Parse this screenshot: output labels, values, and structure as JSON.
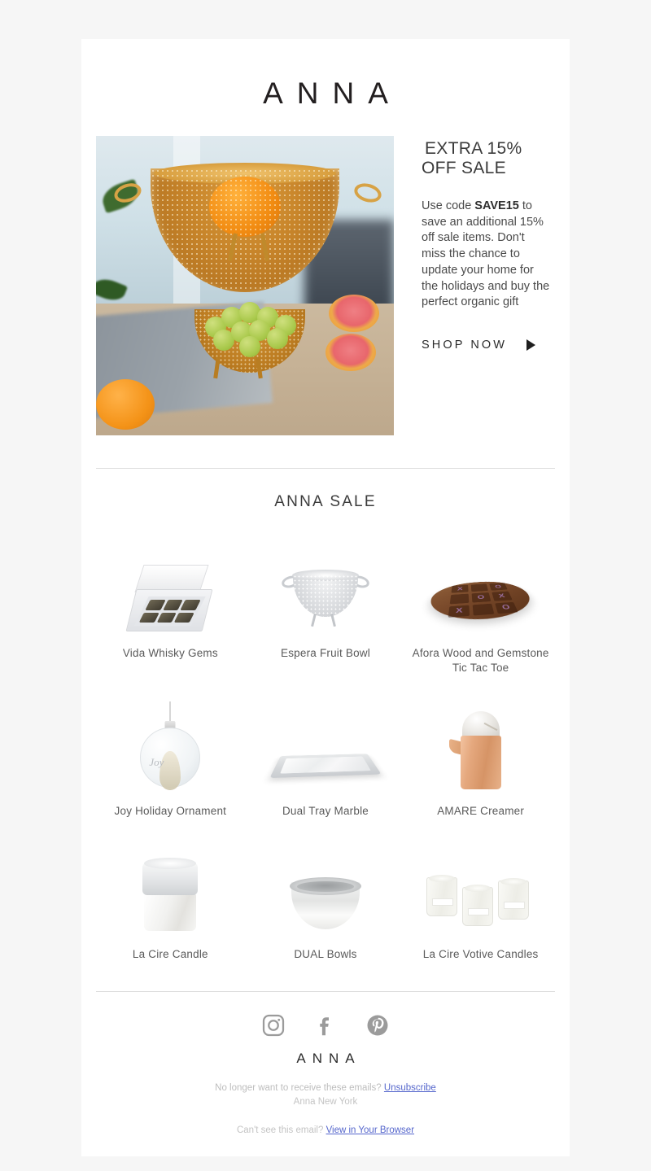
{
  "brand": {
    "logo": "ANNA",
    "footer_logo": "ANNA"
  },
  "hero": {
    "heading_line1": "EXTRA 15%",
    "heading_line2": "OFF SALE",
    "body_pre": "Use code ",
    "body_code": "SAVE15",
    "body_post": " to save an additional 15% off sale items.  Don't miss the chance to update your home for the holidays and buy the perfect organic gift",
    "cta_label": "SHOP NOW",
    "image_alt": "gold perforated fruit bowl with orange, grapes and grapefruit"
  },
  "sale": {
    "title": "ANNA SALE",
    "products": [
      {
        "name": "Vida Whisky Gems"
      },
      {
        "name": "Espera Fruit Bowl"
      },
      {
        "name": "Afora Wood and Gemstone Tic Tac Toe"
      },
      {
        "name": "Joy Holiday Ornament"
      },
      {
        "name": "Dual Tray Marble"
      },
      {
        "name": "AMARE Creamer"
      },
      {
        "name": "La Cire Candle"
      },
      {
        "name": "DUAL Bowls"
      },
      {
        "name": "La Cire Votive Candles"
      }
    ]
  },
  "socials": [
    {
      "icon": "instagram-icon",
      "label": "Instagram"
    },
    {
      "icon": "facebook-icon",
      "label": "Facebook"
    },
    {
      "icon": "pinterest-icon",
      "label": "Pinterest"
    }
  ],
  "footer": {
    "unsubscribe_prefix": "No longer want to receive these emails? ",
    "unsubscribe_link": "Unsubscribe",
    "company": "Anna New York",
    "browser_prefix": "Can't see this email? ",
    "browser_link": "View in Your Browser"
  },
  "colors": {
    "page_bg": "#f6f6f6",
    "email_bg": "#ffffff",
    "text": "#3b3b3b",
    "muted": "#c4c4c4",
    "link": "#5566cc"
  }
}
